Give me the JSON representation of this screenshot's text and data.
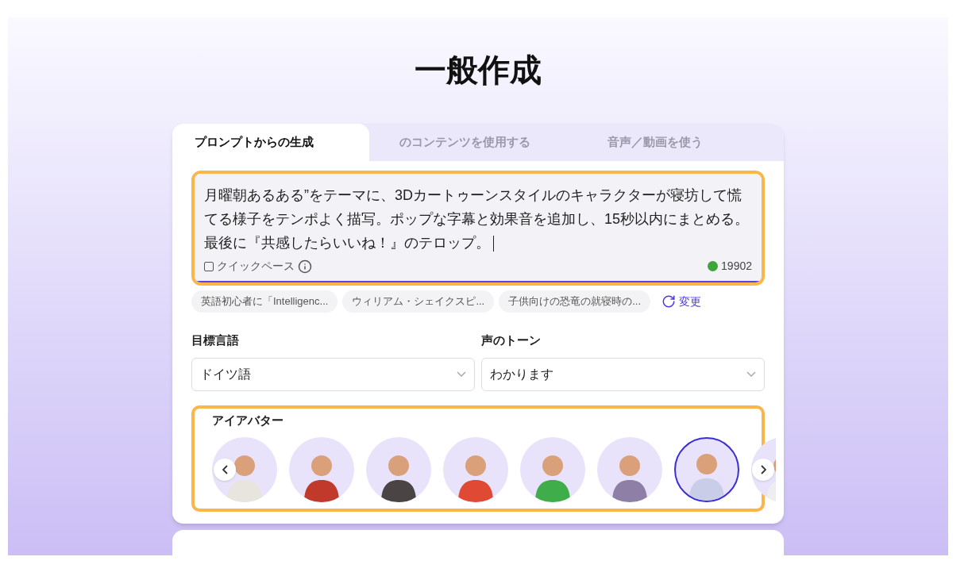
{
  "title": "一般作成",
  "tabs": [
    {
      "label": "プロンプトからの生成",
      "selected": true
    },
    {
      "label": "のコンテンツを使用する",
      "selected": false
    },
    {
      "label": "音声／動画を使う",
      "selected": false
    }
  ],
  "prompt": {
    "value": "月曜朝あるある”をテーマに、3Dカートゥーンスタイルのキャラクターが寝坊して慌てる様子をテンポよく描写。ポップな字幕と効果音を追加し、15秒以内にまとめる。最後に『共感したらいいね！』のテロップ。",
    "quick_pace": {
      "label": "クイックペース",
      "checked": false
    },
    "credits": "19902"
  },
  "suggestions": [
    "英語初心者に「Intelligenc...",
    "ウィリアム・シェイクスピ...",
    "子供向けの恐竜の就寝時の..."
  ],
  "refresh": "変更",
  "fields": [
    {
      "label": "目標言語",
      "value": "ドイツ語"
    },
    {
      "label": "声のトーン",
      "value": "わかります"
    }
  ],
  "avatars": {
    "label": "アイアバター",
    "items": [
      {
        "selected": false,
        "color": "#e8e4de"
      },
      {
        "selected": false,
        "color": "#c0392b"
      },
      {
        "selected": false,
        "color": "#4a4444"
      },
      {
        "selected": false,
        "color": "#e04a35"
      },
      {
        "selected": false,
        "color": "#3fae4a"
      },
      {
        "selected": false,
        "color": "#8e7fa6"
      },
      {
        "selected": true,
        "color": "#c9cde8"
      },
      {
        "selected": false,
        "color": "#eeeeee"
      }
    ]
  }
}
